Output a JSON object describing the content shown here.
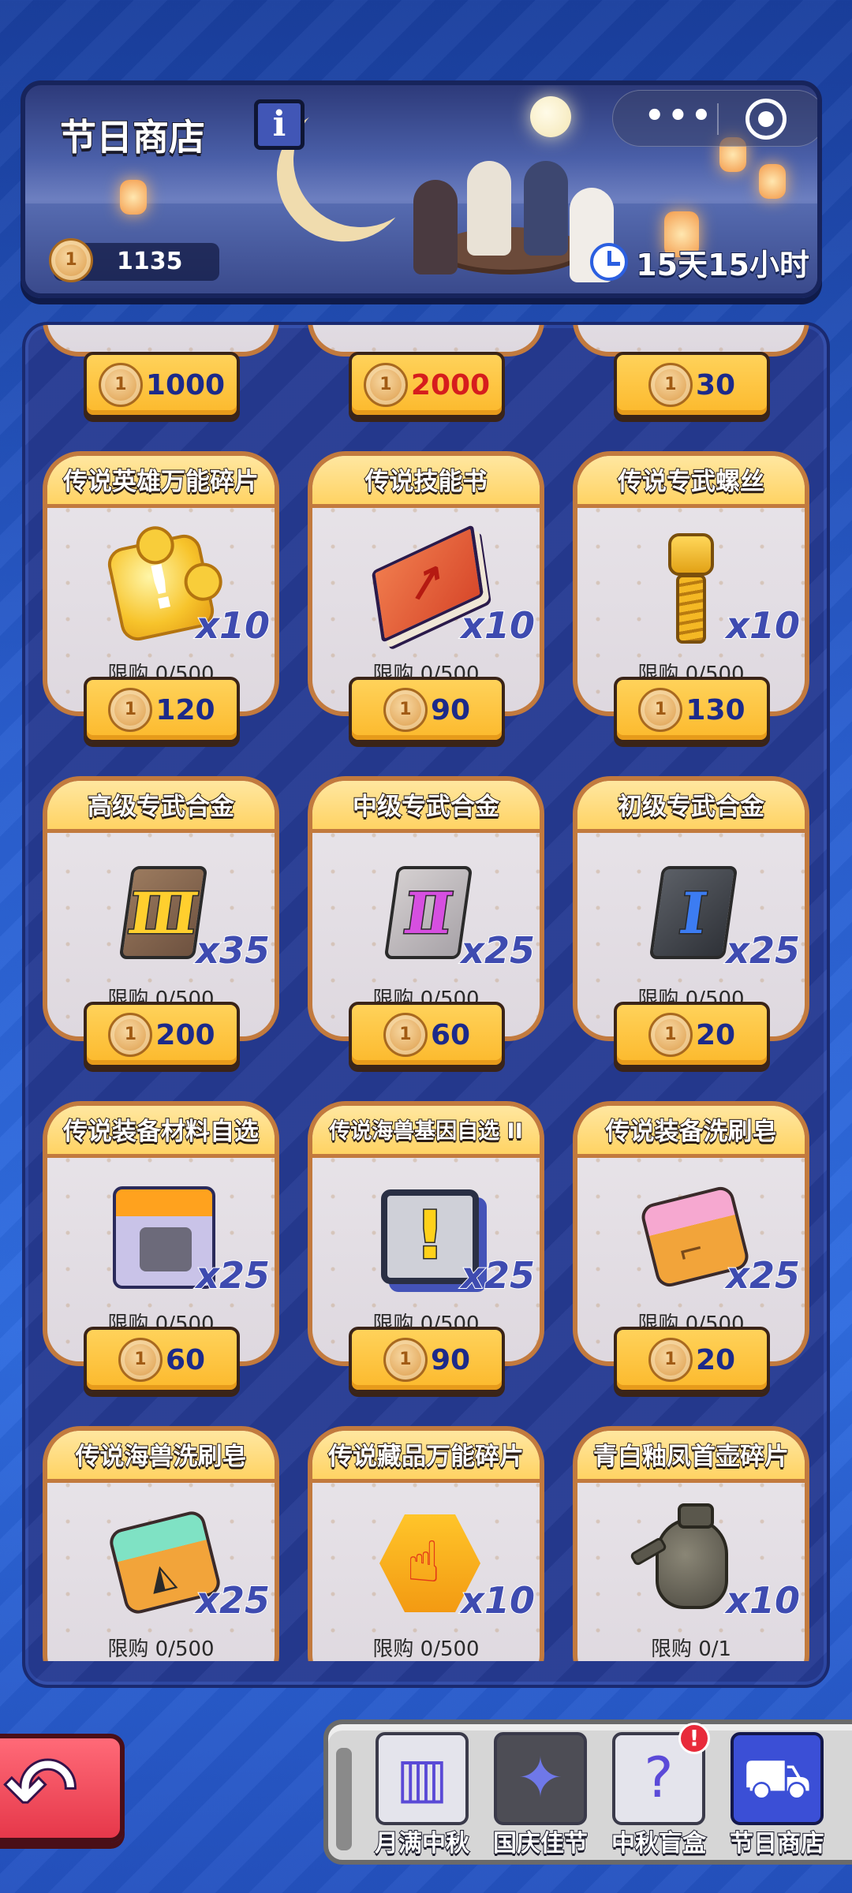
{
  "header": {
    "title": "节日商店",
    "info_label": "i",
    "coins": "1135",
    "timer": "15天15小时"
  },
  "top_row_prices": [
    {
      "price": "1000",
      "highlight": false
    },
    {
      "price": "2000",
      "highlight": true
    },
    {
      "price": "30",
      "highlight": false
    }
  ],
  "items": [
    {
      "name": "传说英雄万能碎片",
      "qty": "x10",
      "limit": "限购 0/500",
      "price": "120",
      "icon": "golden-puzzle-icon"
    },
    {
      "name": "传说技能书",
      "qty": "x10",
      "limit": "限购 0/500",
      "price": "90",
      "icon": "skill-book-icon"
    },
    {
      "name": "传说专武螺丝",
      "qty": "x10",
      "limit": "限购 0/500",
      "price": "130",
      "icon": "golden-screw-icon"
    },
    {
      "name": "高级专武合金",
      "qty": "x35",
      "limit": "限购 0/500",
      "price": "200",
      "icon": "alloy-iii-icon"
    },
    {
      "name": "中级专武合金",
      "qty": "x25",
      "limit": "限购 0/500",
      "price": "60",
      "icon": "alloy-ii-icon"
    },
    {
      "name": "初级专武合金",
      "qty": "x25",
      "limit": "限购 0/500",
      "price": "20",
      "icon": "alloy-i-icon"
    },
    {
      "name": "传说装备材料自选",
      "qty": "x25",
      "limit": "限购 0/500",
      "price": "60",
      "icon": "material-crate-icon"
    },
    {
      "name": "传说海兽基因自选 II",
      "qty": "x25",
      "limit": "限购 0/500",
      "price": "90",
      "icon": "gene-monitor-icon"
    },
    {
      "name": "传说装备洗刷皂",
      "qty": "x25",
      "limit": "限购 0/500",
      "price": "20",
      "icon": "equipment-soap-icon"
    },
    {
      "name": "传说海兽洗刷皂",
      "qty": "x25",
      "limit": "限购 0/500",
      "price": "",
      "icon": "beast-soap-icon"
    },
    {
      "name": "传说藏品万能碎片",
      "qty": "x10",
      "limit": "限购 0/500",
      "price": "",
      "icon": "collectible-shard-icon"
    },
    {
      "name": "青白釉凤首壶碎片",
      "qty": "x10",
      "limit": "限购 0/1",
      "price": "",
      "icon": "phoenix-vase-icon"
    }
  ],
  "nav": {
    "back_label": "",
    "tabs": [
      {
        "label": "月满中秋",
        "icon": "mooncake-tab-icon"
      },
      {
        "label": "国庆佳节",
        "icon": "celebration-tab-icon"
      },
      {
        "label": "中秋盲盒",
        "icon": "blind-box-tab-icon",
        "alert": "!"
      },
      {
        "label": "节日商店",
        "icon": "shopping-cart-icon"
      }
    ]
  },
  "colors": {
    "background": "#2a5fd0",
    "panel": "#253a92",
    "card_frame": "#c27a3e",
    "price_button": "#fcb92c",
    "price_text": "#1c2a8a",
    "price_text_highlight": "#d61d1d",
    "qty_text": "#3e4bb0"
  }
}
